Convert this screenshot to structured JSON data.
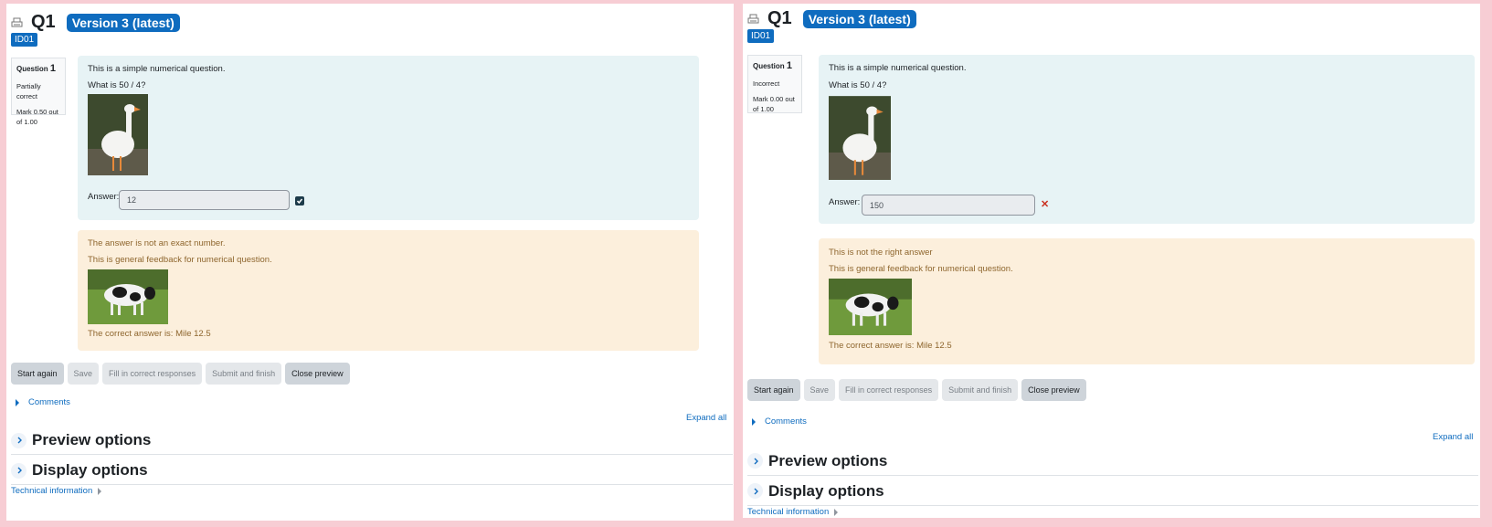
{
  "panels": {
    "left": {
      "title": "Q1",
      "version_badge": "Version 3 (latest)",
      "id_badge": "ID01",
      "info": {
        "question_label": "Question",
        "question_number": "1",
        "state": "Partially correct",
        "mark": "Mark 0.50 out of 1.00"
      },
      "question_text_1": "This is a simple numerical question.",
      "question_text_2": "What is 50 / 4?",
      "answer_label": "Answer:",
      "answer_value": "12",
      "feedback": {
        "specific": "The answer is not an exact number.",
        "general": "This is general feedback for numerical question.",
        "correct_answer": "The correct answer is: Mile 12.5"
      },
      "buttons": {
        "start_again": "Start again",
        "save": "Save",
        "fill_correct": "Fill in correct responses",
        "submit_finish": "Submit and finish",
        "close_preview": "Close preview"
      },
      "comments_link": "Comments",
      "expand_all": "Expand all",
      "sections": [
        "Preview options",
        "Display options"
      ],
      "technical_info": "Technical information"
    },
    "right": {
      "title": "Q1",
      "version_badge": "Version 3 (latest)",
      "id_badge": "ID01",
      "info": {
        "question_label": "Question",
        "question_number": "1",
        "state": "Incorrect",
        "mark": "Mark 0.00 out of 1.00"
      },
      "question_text_1": "This is a simple numerical question.",
      "question_text_2": "What is 50 / 4?",
      "answer_label": "Answer:",
      "answer_value": "150",
      "feedback": {
        "specific": "This is not the right answer",
        "general": "This is general feedback for numerical question.",
        "correct_answer": "The correct answer is: Mile 12.5"
      },
      "buttons": {
        "start_again": "Start again",
        "save": "Save",
        "fill_correct": "Fill in correct responses",
        "submit_finish": "Submit and finish",
        "close_preview": "Close preview"
      },
      "comments_link": "Comments",
      "expand_all": "Expand all",
      "sections": [
        "Preview options",
        "Display options"
      ],
      "technical_info": "Technical information"
    }
  },
  "icons": {
    "print": "print-icon",
    "correct_mark": "check-square-icon",
    "incorrect_mark": "cross-icon",
    "expand": "chevron-right-icon"
  },
  "colors": {
    "page_background": "#f7cdd4",
    "accent": "#0f6cbf",
    "formulation_bg": "#e7f3f5",
    "feedback_bg": "#fcefdc",
    "feedback_text": "#8e662e",
    "incorrect": "#ca3120"
  }
}
